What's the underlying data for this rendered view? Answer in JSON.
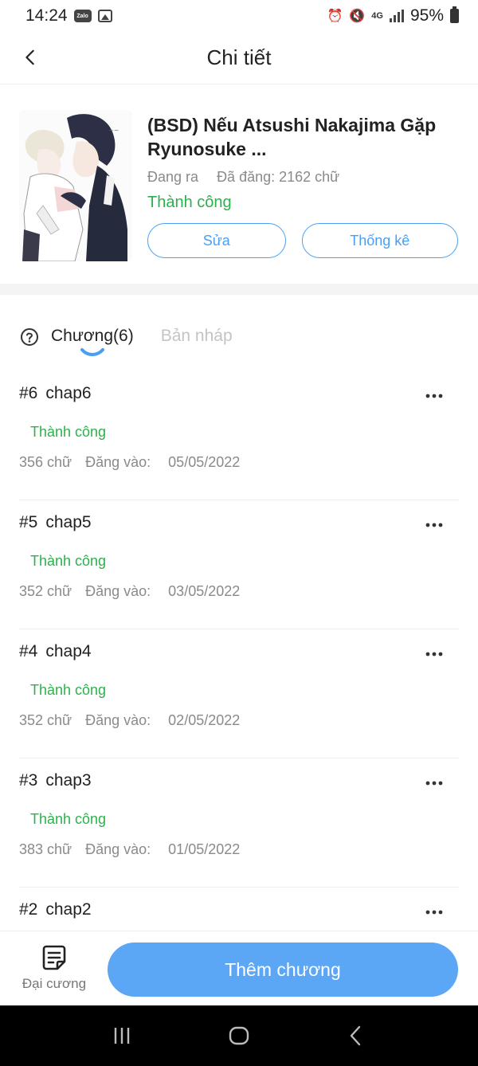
{
  "status_bar": {
    "time": "14:24",
    "zalo": "Zalo",
    "network": "4G",
    "battery": "95%"
  },
  "header": {
    "title": "Chi tiết"
  },
  "book": {
    "title": "(BSD) Nếu Atsushi Nakajima Gặp Ryunosuke ...",
    "state": "Đang ra",
    "posted": "Đã đăng: 2162 chữ",
    "status": "Thành công",
    "edit_label": "Sửa",
    "stats_label": "Thống kê"
  },
  "tabs": {
    "chapters": "Chương(6)",
    "drafts": "Bản nháp"
  },
  "chapters": [
    {
      "num": "#6",
      "name": "chap6",
      "status": "Thành công",
      "words": "356 chữ",
      "posted_label": "Đăng vào:",
      "date": "05/05/2022"
    },
    {
      "num": "#5",
      "name": "chap5",
      "status": "Thành công",
      "words": "352 chữ",
      "posted_label": "Đăng vào:",
      "date": "03/05/2022"
    },
    {
      "num": "#4",
      "name": "chap4",
      "status": "Thành công",
      "words": "352 chữ",
      "posted_label": "Đăng vào:",
      "date": "02/05/2022"
    },
    {
      "num": "#3",
      "name": "chap3",
      "status": "Thành công",
      "words": "383 chữ",
      "posted_label": "Đăng vào:",
      "date": "01/05/2022"
    },
    {
      "num": "#2",
      "name": "chap2"
    }
  ],
  "bottom": {
    "outline_label": "Đại cương",
    "add_label": "Thêm chương"
  },
  "colors": {
    "accent": "#5ba6f5",
    "success": "#2bb24c",
    "muted": "#8a8a8a"
  }
}
